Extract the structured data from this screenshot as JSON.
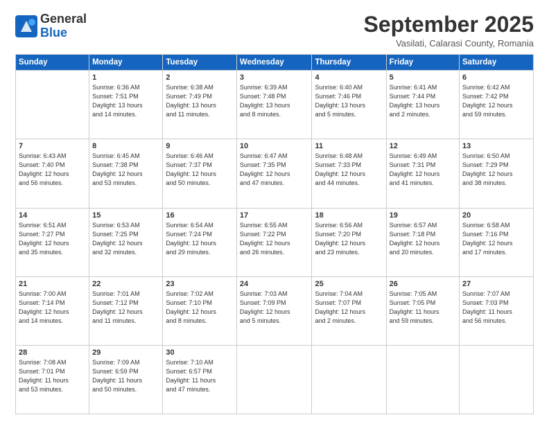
{
  "header": {
    "logo_general": "General",
    "logo_blue": "Blue",
    "month": "September 2025",
    "location": "Vasilati, Calarasi County, Romania"
  },
  "days_of_week": [
    "Sunday",
    "Monday",
    "Tuesday",
    "Wednesday",
    "Thursday",
    "Friday",
    "Saturday"
  ],
  "weeks": [
    [
      {
        "num": "",
        "info": ""
      },
      {
        "num": "1",
        "info": "Sunrise: 6:36 AM\nSunset: 7:51 PM\nDaylight: 13 hours\nand 14 minutes."
      },
      {
        "num": "2",
        "info": "Sunrise: 6:38 AM\nSunset: 7:49 PM\nDaylight: 13 hours\nand 11 minutes."
      },
      {
        "num": "3",
        "info": "Sunrise: 6:39 AM\nSunset: 7:48 PM\nDaylight: 13 hours\nand 8 minutes."
      },
      {
        "num": "4",
        "info": "Sunrise: 6:40 AM\nSunset: 7:46 PM\nDaylight: 13 hours\nand 5 minutes."
      },
      {
        "num": "5",
        "info": "Sunrise: 6:41 AM\nSunset: 7:44 PM\nDaylight: 13 hours\nand 2 minutes."
      },
      {
        "num": "6",
        "info": "Sunrise: 6:42 AM\nSunset: 7:42 PM\nDaylight: 12 hours\nand 59 minutes."
      }
    ],
    [
      {
        "num": "7",
        "info": "Sunrise: 6:43 AM\nSunset: 7:40 PM\nDaylight: 12 hours\nand 56 minutes."
      },
      {
        "num": "8",
        "info": "Sunrise: 6:45 AM\nSunset: 7:38 PM\nDaylight: 12 hours\nand 53 minutes."
      },
      {
        "num": "9",
        "info": "Sunrise: 6:46 AM\nSunset: 7:37 PM\nDaylight: 12 hours\nand 50 minutes."
      },
      {
        "num": "10",
        "info": "Sunrise: 6:47 AM\nSunset: 7:35 PM\nDaylight: 12 hours\nand 47 minutes."
      },
      {
        "num": "11",
        "info": "Sunrise: 6:48 AM\nSunset: 7:33 PM\nDaylight: 12 hours\nand 44 minutes."
      },
      {
        "num": "12",
        "info": "Sunrise: 6:49 AM\nSunset: 7:31 PM\nDaylight: 12 hours\nand 41 minutes."
      },
      {
        "num": "13",
        "info": "Sunrise: 6:50 AM\nSunset: 7:29 PM\nDaylight: 12 hours\nand 38 minutes."
      }
    ],
    [
      {
        "num": "14",
        "info": "Sunrise: 6:51 AM\nSunset: 7:27 PM\nDaylight: 12 hours\nand 35 minutes."
      },
      {
        "num": "15",
        "info": "Sunrise: 6:53 AM\nSunset: 7:25 PM\nDaylight: 12 hours\nand 32 minutes."
      },
      {
        "num": "16",
        "info": "Sunrise: 6:54 AM\nSunset: 7:24 PM\nDaylight: 12 hours\nand 29 minutes."
      },
      {
        "num": "17",
        "info": "Sunrise: 6:55 AM\nSunset: 7:22 PM\nDaylight: 12 hours\nand 26 minutes."
      },
      {
        "num": "18",
        "info": "Sunrise: 6:56 AM\nSunset: 7:20 PM\nDaylight: 12 hours\nand 23 minutes."
      },
      {
        "num": "19",
        "info": "Sunrise: 6:57 AM\nSunset: 7:18 PM\nDaylight: 12 hours\nand 20 minutes."
      },
      {
        "num": "20",
        "info": "Sunrise: 6:58 AM\nSunset: 7:16 PM\nDaylight: 12 hours\nand 17 minutes."
      }
    ],
    [
      {
        "num": "21",
        "info": "Sunrise: 7:00 AM\nSunset: 7:14 PM\nDaylight: 12 hours\nand 14 minutes."
      },
      {
        "num": "22",
        "info": "Sunrise: 7:01 AM\nSunset: 7:12 PM\nDaylight: 12 hours\nand 11 minutes."
      },
      {
        "num": "23",
        "info": "Sunrise: 7:02 AM\nSunset: 7:10 PM\nDaylight: 12 hours\nand 8 minutes."
      },
      {
        "num": "24",
        "info": "Sunrise: 7:03 AM\nSunset: 7:09 PM\nDaylight: 12 hours\nand 5 minutes."
      },
      {
        "num": "25",
        "info": "Sunrise: 7:04 AM\nSunset: 7:07 PM\nDaylight: 12 hours\nand 2 minutes."
      },
      {
        "num": "26",
        "info": "Sunrise: 7:05 AM\nSunset: 7:05 PM\nDaylight: 11 hours\nand 59 minutes."
      },
      {
        "num": "27",
        "info": "Sunrise: 7:07 AM\nSunset: 7:03 PM\nDaylight: 11 hours\nand 56 minutes."
      }
    ],
    [
      {
        "num": "28",
        "info": "Sunrise: 7:08 AM\nSunset: 7:01 PM\nDaylight: 11 hours\nand 53 minutes."
      },
      {
        "num": "29",
        "info": "Sunrise: 7:09 AM\nSunset: 6:59 PM\nDaylight: 11 hours\nand 50 minutes."
      },
      {
        "num": "30",
        "info": "Sunrise: 7:10 AM\nSunset: 6:57 PM\nDaylight: 11 hours\nand 47 minutes."
      },
      {
        "num": "",
        "info": ""
      },
      {
        "num": "",
        "info": ""
      },
      {
        "num": "",
        "info": ""
      },
      {
        "num": "",
        "info": ""
      }
    ]
  ]
}
